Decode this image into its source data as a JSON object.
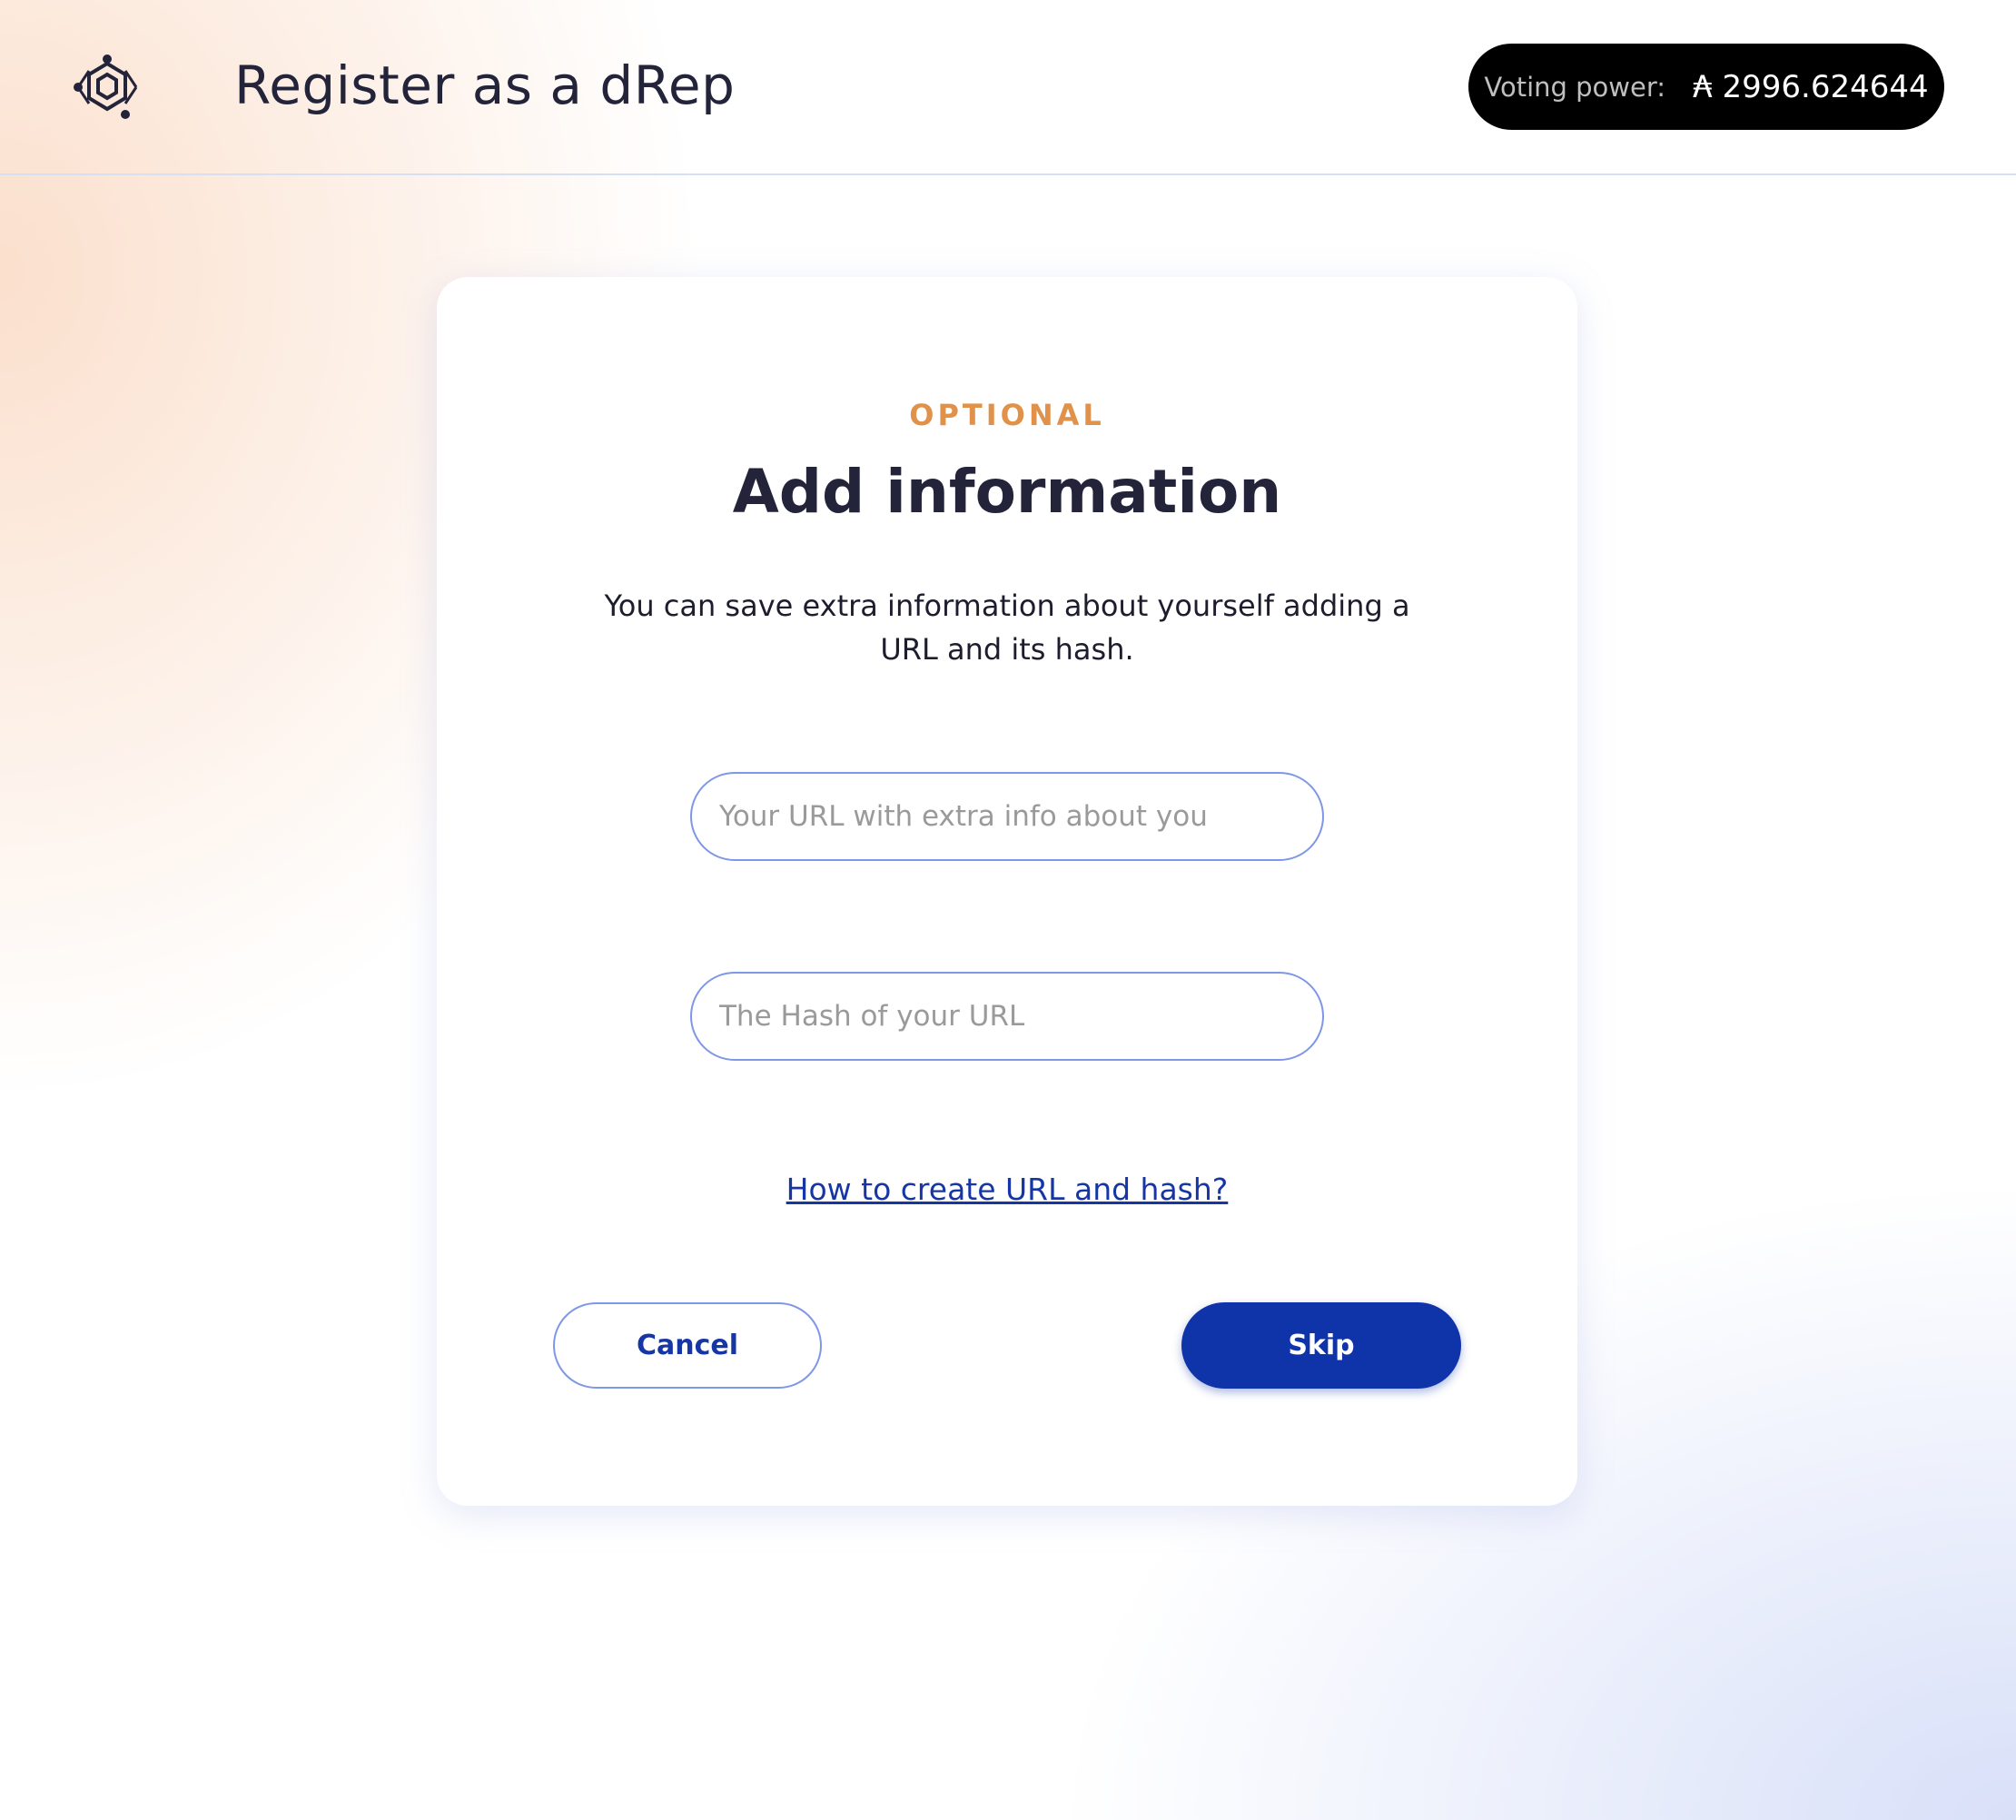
{
  "header": {
    "title": "Register as a dRep",
    "logo_icon": "hexagon-logo-icon",
    "voting_power_label": "Voting power:",
    "voting_power_value": "₳ 2996.624644"
  },
  "card": {
    "tag": "OPTIONAL",
    "title": "Add information",
    "description": "You can save extra information about yourself adding a URL and its hash.",
    "url_field": {
      "placeholder": "Your URL with extra info about you",
      "value": ""
    },
    "hash_field": {
      "placeholder": "The Hash of your URL",
      "value": ""
    },
    "help_link": "How to create URL and hash?",
    "cancel_label": "Cancel",
    "skip_label": "Skip"
  },
  "colors": {
    "accent": "#0f33a8",
    "optional_tag": "#e0924a",
    "field_border": "#7e97e6",
    "pill_bg": "#000000"
  }
}
